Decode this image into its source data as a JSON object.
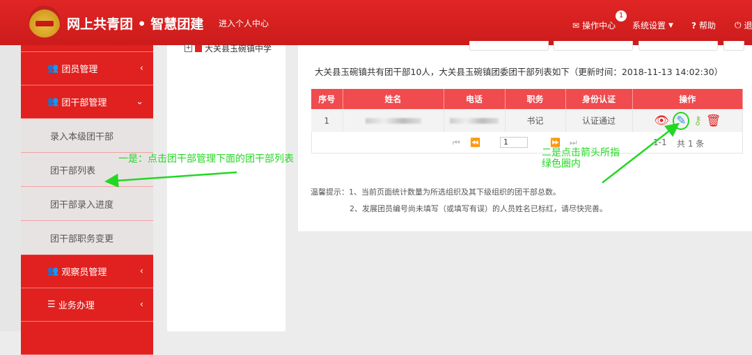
{
  "header": {
    "title": "网上共青团 • 智慧团建",
    "personal_center": "进入个人中心",
    "nav": [
      {
        "label": "操作中心",
        "icon": "envelope-icon",
        "badge": "1"
      },
      {
        "label": "系统设置",
        "icon": "caret-down-icon"
      },
      {
        "label": "帮助",
        "icon": "question-icon"
      },
      {
        "label": "退",
        "icon": "power-icon"
      }
    ]
  },
  "sidebar": {
    "items": [
      {
        "label": "团员管理",
        "chevron": "‹"
      },
      {
        "label": "团干部管理",
        "chevron": "⌄",
        "sub": [
          "录入本级团干部",
          "团干部列表",
          "团干部录入进度",
          "团干部职务变更"
        ]
      },
      {
        "label": "观察员管理",
        "chevron": "‹"
      },
      {
        "label": "业务办理",
        "chevron": "‹"
      }
    ]
  },
  "tree": {
    "node": "大关县玉碗镇中学"
  },
  "main": {
    "summary": "大关县玉碗镇共有团干部10人，大关县玉碗镇团委团干部列表如下（更新时间：2018-11-13 14:02:30）",
    "columns": [
      "序号",
      "姓名",
      "电话",
      "职务",
      "身份认证",
      "操作"
    ],
    "rows": [
      {
        "index": "1",
        "name": "",
        "phone": "",
        "position": "书记",
        "auth": "认证通过"
      }
    ],
    "pager": {
      "page": "1",
      "range": "1-1",
      "total": "共 1 条"
    },
    "tips": [
      "温馨提示：1、当前页面统计数量为所选组织及其下级组织的团干部总数。",
      "2、发展团员编号尚未填写（或填写有误）的人员姓名已标红，请尽快完善。"
    ]
  },
  "annotations": {
    "first": "一是：点击团干部管理下面的团干部列表",
    "second_line1": "二是点击箭头所指",
    "second_line2": "绿色圈内"
  },
  "colors": {
    "header": "#d9201f",
    "table_header": "#f04b4e",
    "annotation": "#22d822"
  }
}
